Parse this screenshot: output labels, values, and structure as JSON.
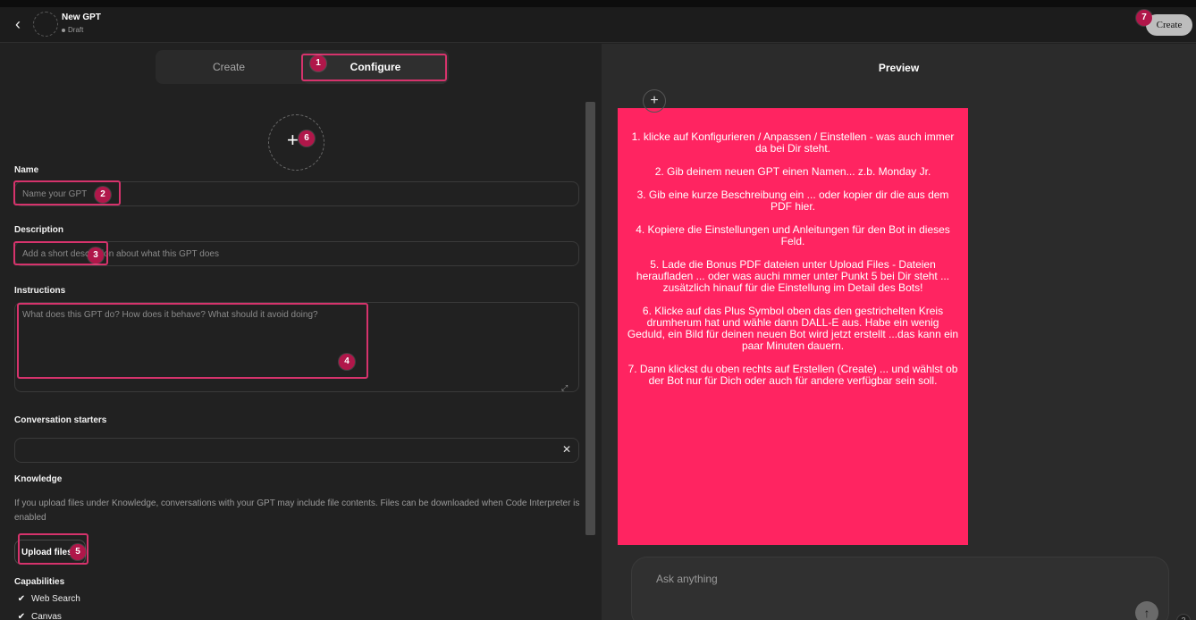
{
  "header": {
    "back_icon": "‹",
    "title": "New GPT",
    "status": "Draft",
    "create_label": "Create"
  },
  "tabs": [
    {
      "label": "Create"
    },
    {
      "label": "Configure"
    }
  ],
  "form": {
    "avatar_plus": "+",
    "name_label": "Name",
    "name_placeholder": "Name your GPT",
    "description_label": "Description",
    "description_placeholder": "Add a short description about what this GPT does",
    "instructions_label": "Instructions",
    "instructions_placeholder": "What does this GPT do? How does it behave? What should it avoid doing?",
    "resize_icon": "⤢",
    "starters_label": "Conversation starters",
    "starters_value": "",
    "clear_icon": "✕",
    "knowledge_label": "Knowledge",
    "knowledge_help": "If you upload files under Knowledge, conversations with your GPT may include file contents. Files can be downloaded when Code Interpreter is enabled",
    "upload_label": "Upload files",
    "capabilities_label": "Capabilities",
    "capabilities": [
      {
        "label": "Web Search",
        "checked": true
      },
      {
        "label": "Canvas",
        "checked": true
      }
    ]
  },
  "preview": {
    "title": "Preview",
    "note": [
      "1. klicke auf Konfigurieren / Anpassen / Einstellen - was auch immer da bei Dir steht.",
      "2. Gib deinem neuen GPT einen Namen... z.b. Monday Jr.",
      "3. Gib eine kurze Beschreibung ein ... oder kopier dir die aus dem PDF hier.",
      "4. Kopiere die Einstellungen und Anleitungen für den Bot in dieses Feld.",
      "5. Lade die Bonus PDF dateien unter Upload Files - Dateien heraufladen ... oder was auchi mmer unter Punkt 5 bei Dir steht ... zusätzlich hinauf für die Einstellung im Detail des Bots!",
      "6. Klicke auf das Plus Symbol oben das den gestrichelten Kreis drumherum hat und wähle dann DALL-E aus. Habe ein wenig Geduld, ein Bild für deinen neuen Bot wird jetzt erstellt ...das kann ein paar Minuten dauern.",
      "7. Dann klickst du oben rechts auf Erstellen (Create) ... und wählst ob der Bot nur für Dich oder auch für andere verfügbar sein soll."
    ],
    "composer_placeholder": "Ask anything",
    "plus_icon": "+",
    "send_icon": "↑",
    "help_icon": "?"
  },
  "annotations": [
    "1",
    "2",
    "3",
    "4",
    "5",
    "6",
    "7"
  ],
  "colors": {
    "note_bg": "#ff2461",
    "badge": "#b0174a",
    "highlight": "#d6336c"
  }
}
